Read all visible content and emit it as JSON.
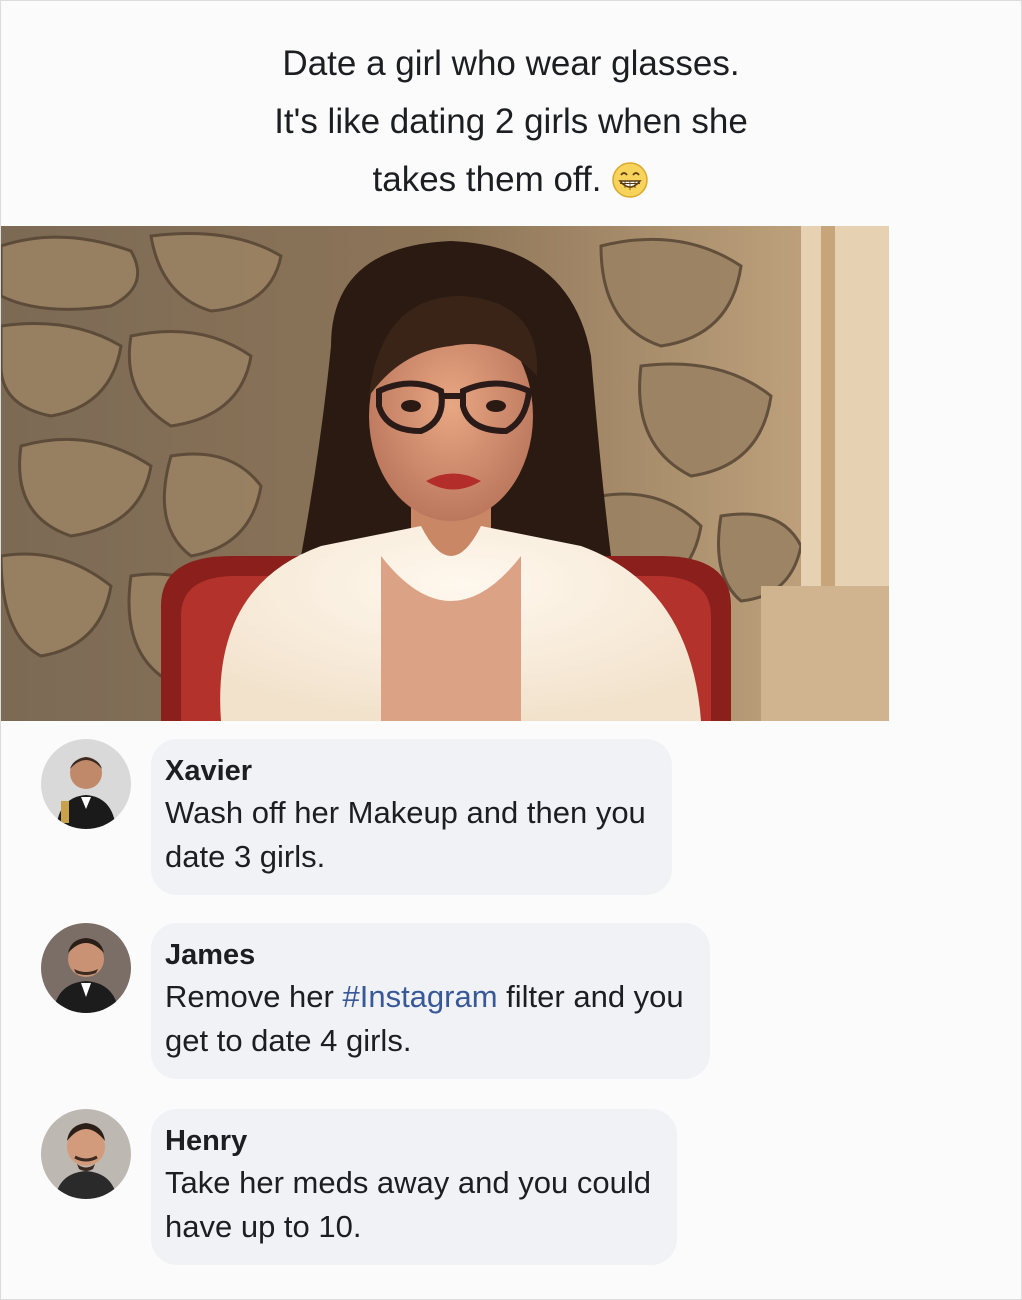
{
  "post": {
    "text_lines": [
      "Date a girl who wear glasses.",
      "It's like dating 2 girls when she",
      "takes them off."
    ],
    "emoji": "grinning-face-with-smiling-eyes"
  },
  "photo": {
    "subject": "woman-with-glasses"
  },
  "comments": [
    {
      "author": "Xavier",
      "text": "Wash off her Makeup and then you\ndate 3 girls."
    },
    {
      "author": "James",
      "text_before": "Remove her ",
      "hashtag": "#Instagram",
      "text_after": " filter and you\nget to date 4 girls."
    },
    {
      "author": "Henry",
      "text": "Take her meds away and you could\nhave up to 10."
    }
  ],
  "colors": {
    "hashtag": "#385898",
    "bubble": "#f0f2f5",
    "text": "#1c1e21"
  }
}
